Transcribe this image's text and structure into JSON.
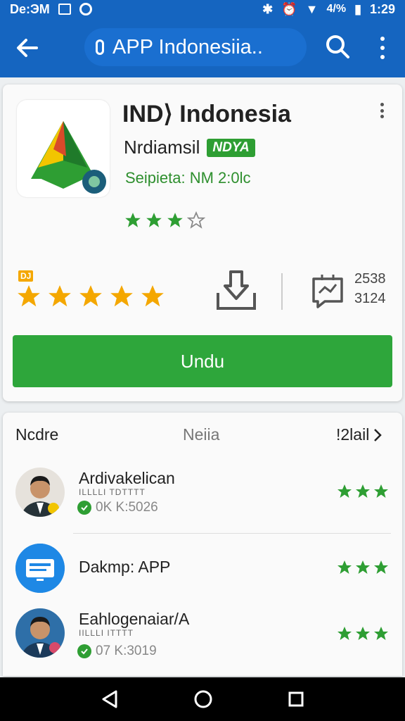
{
  "status_bar": {
    "carrier": "De:ЭM",
    "signal": "4/%",
    "time": "1:29"
  },
  "app_bar": {
    "title": "APP Indonesiia..",
    "back_icon": "arrow-left-icon",
    "search_icon": "search-icon",
    "menu_icon": "more-vert-icon"
  },
  "app": {
    "name": "IND⟩ Indonesia",
    "developer": "Nrdiamsil",
    "badge": "NDYA",
    "updated": "Seipieta: NM 2:0lc",
    "rating_label": "DJ",
    "stat_top": "2538",
    "stat_bottom": "3124",
    "install_label": "Undu"
  },
  "tabs": {
    "left": "Ncdre",
    "middle": "Neiia",
    "right": "!2lail"
  },
  "list": [
    {
      "title": "Ardivakelican",
      "subtitle": "ILLLLI TDTTTT",
      "meta": "0K  K:5026",
      "rating": 3
    },
    {
      "title": "Dakmp: APP",
      "subtitle": "",
      "meta": "",
      "rating": 3
    },
    {
      "title": "Eahlogenaiar/A",
      "subtitle": "IILLLI ITTTT",
      "meta": "07  K:3019",
      "rating": 3
    }
  ],
  "colors": {
    "primary": "#1565c0",
    "accent_green": "#2ea63b",
    "star_gold": "#f4a700",
    "star_green": "#2e9e33"
  }
}
